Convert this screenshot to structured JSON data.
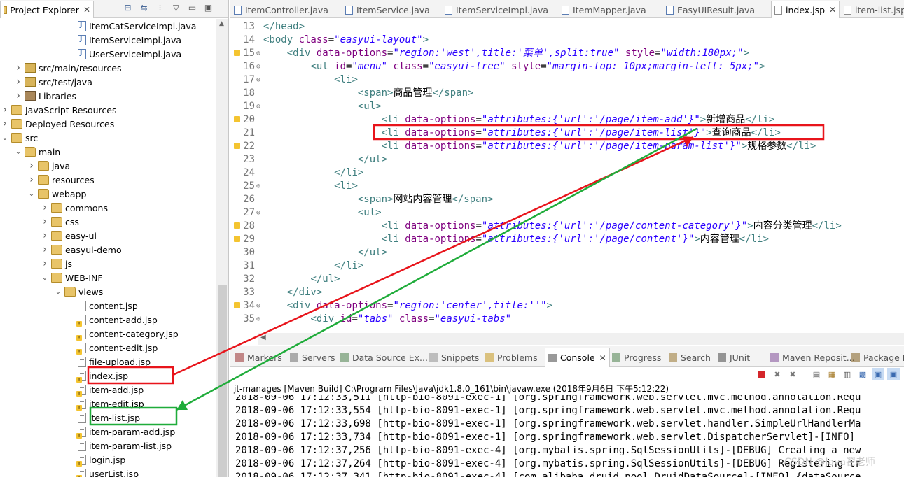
{
  "explorer": {
    "title": "Project Explorer",
    "tree": [
      {
        "label": "ItemCatServiceImpl.java",
        "icon": "java-file-icon",
        "depth": 6
      },
      {
        "label": "ItemServiceImpl.java",
        "icon": "java-file-icon",
        "depth": 6
      },
      {
        "label": "UserServiceImpl.java",
        "icon": "java-file-icon",
        "depth": 6
      },
      {
        "label": "src/main/resources",
        "icon": "source-folder-icon",
        "depth": 2,
        "arrow": "collapsed"
      },
      {
        "label": "src/test/java",
        "icon": "source-folder-icon",
        "depth": 2,
        "arrow": "collapsed"
      },
      {
        "label": "Libraries",
        "icon": "libraries-icon",
        "depth": 2,
        "arrow": "collapsed"
      },
      {
        "label": "JavaScript Resources",
        "icon": "js-resources-icon",
        "depth": 1,
        "arrow": "collapsed"
      },
      {
        "label": "Deployed Resources",
        "icon": "deployed-resources-icon",
        "depth": 1,
        "arrow": "collapsed"
      },
      {
        "label": "src",
        "icon": "folder-icon",
        "depth": 1,
        "arrow": "expanded"
      },
      {
        "label": "main",
        "icon": "folder-icon",
        "depth": 2,
        "arrow": "expanded"
      },
      {
        "label": "java",
        "icon": "folder-icon",
        "depth": 3,
        "arrow": "collapsed"
      },
      {
        "label": "resources",
        "icon": "folder-icon",
        "depth": 3,
        "arrow": "collapsed"
      },
      {
        "label": "webapp",
        "icon": "folder-icon",
        "depth": 3,
        "arrow": "expanded"
      },
      {
        "label": "commons",
        "icon": "folder-icon",
        "depth": 4,
        "arrow": "collapsed"
      },
      {
        "label": "css",
        "icon": "folder-icon",
        "depth": 4,
        "arrow": "collapsed"
      },
      {
        "label": "easy-ui",
        "icon": "folder-icon",
        "depth": 4,
        "arrow": "collapsed"
      },
      {
        "label": "easyui-demo",
        "icon": "folder-icon",
        "depth": 4,
        "arrow": "collapsed"
      },
      {
        "label": "js",
        "icon": "folder-icon",
        "depth": 4,
        "arrow": "collapsed"
      },
      {
        "label": "WEB-INF",
        "icon": "folder-icon",
        "depth": 4,
        "arrow": "expanded"
      },
      {
        "label": "views",
        "icon": "folder-icon",
        "depth": 5,
        "arrow": "expanded"
      },
      {
        "label": "content.jsp",
        "icon": "jsp-file-icon",
        "depth": 6
      },
      {
        "label": "content-add.jsp",
        "icon": "jsp-file-icon",
        "depth": 6,
        "warn": true
      },
      {
        "label": "content-category.jsp",
        "icon": "jsp-file-icon",
        "depth": 6,
        "warn": true
      },
      {
        "label": "content-edit.jsp",
        "icon": "jsp-file-icon",
        "depth": 6,
        "warn": true
      },
      {
        "label": "file-upload.jsp",
        "icon": "jsp-file-icon",
        "depth": 6
      },
      {
        "label": "index.jsp",
        "icon": "jsp-file-icon",
        "depth": 6,
        "warn": true
      },
      {
        "label": "item-add.jsp",
        "icon": "jsp-file-icon",
        "depth": 6,
        "warn": true
      },
      {
        "label": "item-edit.jsp",
        "icon": "jsp-file-icon",
        "depth": 6,
        "warn": true
      },
      {
        "label": "item-list.jsp",
        "icon": "jsp-file-icon",
        "depth": 6
      },
      {
        "label": "item-param-add.jsp",
        "icon": "jsp-file-icon",
        "depth": 6,
        "warn": true
      },
      {
        "label": "item-param-list.jsp",
        "icon": "jsp-file-icon",
        "depth": 6
      },
      {
        "label": "login.jsp",
        "icon": "jsp-file-icon",
        "depth": 6,
        "warn": true
      },
      {
        "label": "userList.jsp",
        "icon": "jsp-file-icon",
        "depth": 6,
        "warn": true
      }
    ]
  },
  "editor": {
    "tabs": [
      {
        "label": "ItemController.java",
        "icon": "java-file-icon",
        "active": false
      },
      {
        "label": "ItemService.java",
        "icon": "java-file-icon",
        "active": false
      },
      {
        "label": "ItemServiceImpl.java",
        "icon": "java-file-icon",
        "active": false
      },
      {
        "label": "ItemMapper.java",
        "icon": "java-file-icon",
        "active": false
      },
      {
        "label": "EasyUIResult.java",
        "icon": "java-file-icon",
        "active": false
      },
      {
        "label": "index.jsp",
        "icon": "jsp-file-icon",
        "active": true
      },
      {
        "label": "item-list.jsp",
        "icon": "jsp-file-icon",
        "active": false
      }
    ],
    "lines": [
      {
        "n": "13",
        "parts": [
          [
            "tg",
            "</head>"
          ]
        ]
      },
      {
        "n": "14",
        "parts": [
          [
            "tg",
            "<body "
          ],
          [
            "an",
            "class"
          ],
          [
            "tx",
            "="
          ],
          [
            "av",
            "\"easyui-layout\""
          ],
          [
            "tg",
            ">"
          ]
        ]
      },
      {
        "n": "15",
        "warn": true,
        "fold": true,
        "parts": [
          [
            "tx",
            "    "
          ],
          [
            "tg",
            "<div "
          ],
          [
            "an",
            "data-options"
          ],
          [
            "tx",
            "="
          ],
          [
            "av",
            "\"region:'west',title:'菜单',split:true\""
          ],
          [
            "tx",
            " "
          ],
          [
            "an",
            "style"
          ],
          [
            "tx",
            "="
          ],
          [
            "av",
            "\"width:180px;\""
          ],
          [
            "tg",
            ">"
          ]
        ]
      },
      {
        "n": "16",
        "fold": true,
        "parts": [
          [
            "tx",
            "        "
          ],
          [
            "tg",
            "<ul "
          ],
          [
            "an",
            "id"
          ],
          [
            "tx",
            "="
          ],
          [
            "av",
            "\"menu\""
          ],
          [
            "tx",
            " "
          ],
          [
            "an",
            "class"
          ],
          [
            "tx",
            "="
          ],
          [
            "av",
            "\"easyui-tree\""
          ],
          [
            "tx",
            " "
          ],
          [
            "an",
            "style"
          ],
          [
            "tx",
            "="
          ],
          [
            "av",
            "\"margin-top: 10px;margin-left: 5px;\""
          ],
          [
            "tg",
            ">"
          ]
        ]
      },
      {
        "n": "17",
        "fold": true,
        "parts": [
          [
            "tx",
            "            "
          ],
          [
            "tg",
            "<li>"
          ]
        ]
      },
      {
        "n": "18",
        "parts": [
          [
            "tx",
            "                "
          ],
          [
            "tg",
            "<span>"
          ],
          [
            "tx",
            "商品管理"
          ],
          [
            "tg",
            "</span>"
          ]
        ]
      },
      {
        "n": "19",
        "fold": true,
        "parts": [
          [
            "tx",
            "                "
          ],
          [
            "tg",
            "<ul>"
          ]
        ]
      },
      {
        "n": "20",
        "warn": true,
        "parts": [
          [
            "tx",
            "                    "
          ],
          [
            "tg",
            "<li "
          ],
          [
            "an",
            "data-options"
          ],
          [
            "tx",
            "="
          ],
          [
            "av",
            "\"attributes:{'url':'/page/item-add'}\""
          ],
          [
            "tg",
            ">"
          ],
          [
            "tx",
            "新增商品"
          ],
          [
            "tg",
            "</li>"
          ]
        ]
      },
      {
        "n": "21",
        "parts": [
          [
            "tx",
            "                    "
          ],
          [
            "tg",
            "<li "
          ],
          [
            "an",
            "data-options"
          ],
          [
            "tx",
            "="
          ],
          [
            "av",
            "\"attributes:{'url':'/page/item-list'}\""
          ],
          [
            "tg",
            ">"
          ],
          [
            "tx",
            "查询商品"
          ],
          [
            "tg",
            "</li>"
          ]
        ]
      },
      {
        "n": "22",
        "warn": true,
        "parts": [
          [
            "tx",
            "                    "
          ],
          [
            "tg",
            "<li "
          ],
          [
            "an",
            "data-options"
          ],
          [
            "tx",
            "="
          ],
          [
            "av",
            "\"attributes:{'url':'/page/item-param-list'}\""
          ],
          [
            "tg",
            ">"
          ],
          [
            "tx",
            "规格参数"
          ],
          [
            "tg",
            "</li>"
          ]
        ]
      },
      {
        "n": "23",
        "parts": [
          [
            "tx",
            "                "
          ],
          [
            "tg",
            "</ul>"
          ]
        ]
      },
      {
        "n": "24",
        "parts": [
          [
            "tx",
            "            "
          ],
          [
            "tg",
            "</li>"
          ]
        ]
      },
      {
        "n": "25",
        "fold": true,
        "parts": [
          [
            "tx",
            "            "
          ],
          [
            "tg",
            "<li>"
          ]
        ]
      },
      {
        "n": "26",
        "parts": [
          [
            "tx",
            "                "
          ],
          [
            "tg",
            "<span>"
          ],
          [
            "tx",
            "网站内容管理"
          ],
          [
            "tg",
            "</span>"
          ]
        ]
      },
      {
        "n": "27",
        "fold": true,
        "parts": [
          [
            "tx",
            "                "
          ],
          [
            "tg",
            "<ul>"
          ]
        ]
      },
      {
        "n": "28",
        "warn": true,
        "parts": [
          [
            "tx",
            "                    "
          ],
          [
            "tg",
            "<li "
          ],
          [
            "an",
            "data-options"
          ],
          [
            "tx",
            "="
          ],
          [
            "av",
            "\"attributes:{'url':'/page/content-category'}\""
          ],
          [
            "tg",
            ">"
          ],
          [
            "tx",
            "内容分类管理"
          ],
          [
            "tg",
            "</li>"
          ]
        ]
      },
      {
        "n": "29",
        "warn": true,
        "parts": [
          [
            "tx",
            "                    "
          ],
          [
            "tg",
            "<li "
          ],
          [
            "an",
            "data-options"
          ],
          [
            "tx",
            "="
          ],
          [
            "av",
            "\"attributes:{'url':'/page/content'}\""
          ],
          [
            "tg",
            ">"
          ],
          [
            "tx",
            "内容管理"
          ],
          [
            "tg",
            "</li>"
          ]
        ]
      },
      {
        "n": "30",
        "parts": [
          [
            "tx",
            "                "
          ],
          [
            "tg",
            "</ul>"
          ]
        ]
      },
      {
        "n": "31",
        "parts": [
          [
            "tx",
            "            "
          ],
          [
            "tg",
            "</li>"
          ]
        ]
      },
      {
        "n": "32",
        "parts": [
          [
            "tx",
            "        "
          ],
          [
            "tg",
            "</ul>"
          ]
        ]
      },
      {
        "n": "33",
        "parts": [
          [
            "tx",
            "    "
          ],
          [
            "tg",
            "</div>"
          ]
        ]
      },
      {
        "n": "34",
        "warn": true,
        "fold": true,
        "parts": [
          [
            "tx",
            "    "
          ],
          [
            "tg",
            "<div "
          ],
          [
            "an",
            "data-options"
          ],
          [
            "tx",
            "="
          ],
          [
            "av",
            "\"region:'center',title:''\""
          ],
          [
            "tg",
            ">"
          ]
        ]
      },
      {
        "n": "35",
        "fold": true,
        "parts": [
          [
            "tx",
            "        "
          ],
          [
            "tg",
            "<div "
          ],
          [
            "an",
            "id"
          ],
          [
            "tx",
            "="
          ],
          [
            "av",
            "\"tabs\""
          ],
          [
            "tx",
            " "
          ],
          [
            "an",
            "class"
          ],
          [
            "tx",
            "="
          ],
          [
            "av",
            "\"easyui-tabs\""
          ]
        ]
      }
    ]
  },
  "bottom": {
    "tabs": [
      {
        "label": "Markers",
        "icon": "markers-icon",
        "active": false
      },
      {
        "label": "Servers",
        "icon": "servers-icon",
        "active": false
      },
      {
        "label": "Data Source Ex...",
        "icon": "data-source-icon",
        "active": false
      },
      {
        "label": "Snippets",
        "icon": "snippets-icon",
        "active": false
      },
      {
        "label": "Problems",
        "icon": "problems-icon",
        "active": false
      },
      {
        "label": "Console",
        "icon": "console-icon",
        "active": true
      },
      {
        "label": "Progress",
        "icon": "progress-icon",
        "active": false
      },
      {
        "label": "Search",
        "icon": "search-icon",
        "active": false
      },
      {
        "label": "JUnit",
        "icon": "junit-icon",
        "active": false
      },
      {
        "label": "Maven Reposit...",
        "icon": "maven-icon",
        "active": false
      },
      {
        "label": "Package E",
        "icon": "package-explorer-icon",
        "active": false
      }
    ],
    "console_title": "jt-manages [Maven Build] C:\\Program Files\\Java\\jdk1.8.0_161\\bin\\javaw.exe (2018年9月6日 下午5:12:22)",
    "console_lines": [
      "2018-09-06 17:12:33,511 [http-bio-8091-exec-1] [org.springframework.web.servlet.mvc.method.annotation.Requ",
      "2018-09-06 17:12:33,554 [http-bio-8091-exec-1] [org.springframework.web.servlet.mvc.method.annotation.Requ",
      "2018-09-06 17:12:33,698 [http-bio-8091-exec-1] [org.springframework.web.servlet.handler.SimpleUrlHandlerMa",
      "2018-09-06 17:12:33,734 [http-bio-8091-exec-1] [org.springframework.web.servlet.DispatcherServlet]-[INFO]",
      "2018-09-06 17:12:37,256 [http-bio-8091-exec-4] [org.mybatis.spring.SqlSessionUtils]-[DEBUG] Creating a new",
      "2018-09-06 17:12:37,264 [http-bio-8091-exec-4] [org.mybatis.spring.SqlSessionUtils]-[DEBUG] Registering tr",
      "2018-09-06 17:12:37,341 [http-bio-8091-exec-4] [com.alibaba.druid.pool.DruidDataSource]-[INFO] {dataSource"
    ],
    "watermark": "CSDN @Java翟老师"
  },
  "colors": {
    "red_annotation": "#e8141b",
    "green_annotation": "#1fac3a"
  }
}
